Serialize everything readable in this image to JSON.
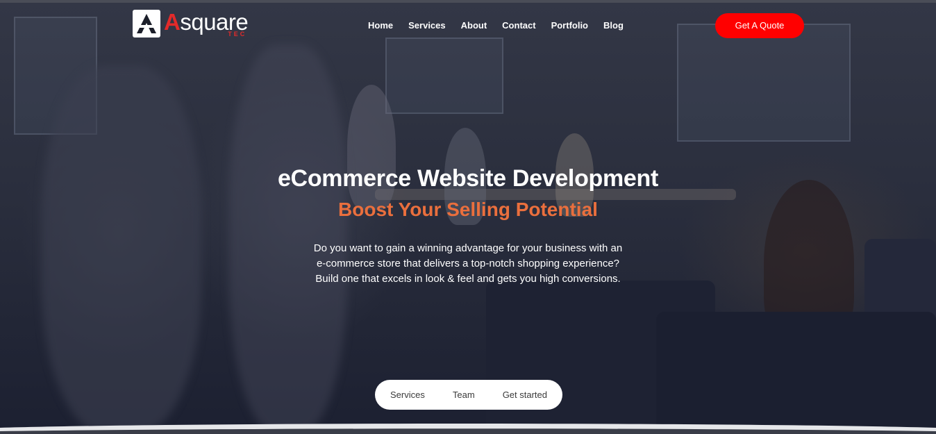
{
  "brand": {
    "initial": "A",
    "rest": "square",
    "tag": "TEC",
    "logo_icon": "asquare-logo-icon"
  },
  "nav": {
    "items": [
      {
        "label": "Home"
      },
      {
        "label": "Services"
      },
      {
        "label": "About"
      },
      {
        "label": "Contact"
      },
      {
        "label": "Portfolio"
      },
      {
        "label": "Blog"
      }
    ]
  },
  "cta": {
    "quote_label": "Get A Quote"
  },
  "hero": {
    "title": "eCommerce Website Development",
    "subtitle": "Boost Your Selling Potential",
    "description": "Do you want to gain a winning advantage for your business with an e-commerce store that delivers a top-notch shopping experience? Build one that excels in look & feel and gets you high conversions."
  },
  "quick_links": {
    "items": [
      {
        "label": "Services"
      },
      {
        "label": "Team"
      },
      {
        "label": "Get started"
      }
    ]
  },
  "colors": {
    "accent_red": "#ff0000",
    "subtitle_orange": "#ea6f3d",
    "overlay": "#2a2e3d"
  }
}
